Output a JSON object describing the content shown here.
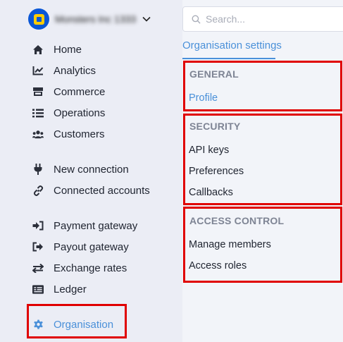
{
  "organisation": {
    "name": "Monsters Inc 1333"
  },
  "sidebar": {
    "items": [
      {
        "id": "home",
        "label": "Home",
        "icon": "home-icon"
      },
      {
        "id": "analytics",
        "label": "Analytics",
        "icon": "analytics-icon"
      },
      {
        "id": "commerce",
        "label": "Commerce",
        "icon": "store-icon"
      },
      {
        "id": "operations",
        "label": "Operations",
        "icon": "list-icon"
      },
      {
        "id": "customers",
        "label": "Customers",
        "icon": "users-icon"
      },
      {
        "id": "new-connection",
        "label": "New connection",
        "icon": "plug-icon"
      },
      {
        "id": "connected-accounts",
        "label": "Connected accounts",
        "icon": "link-icon"
      },
      {
        "id": "payment-gateway",
        "label": "Payment gateway",
        "icon": "sign-in-icon"
      },
      {
        "id": "payout-gateway",
        "label": "Payout gateway",
        "icon": "sign-out-icon"
      },
      {
        "id": "exchange-rates",
        "label": "Exchange rates",
        "icon": "exchange-icon"
      },
      {
        "id": "ledger",
        "label": "Ledger",
        "icon": "ledger-icon"
      },
      {
        "id": "organisation",
        "label": "Organisation",
        "icon": "gear-icon",
        "active": true
      }
    ]
  },
  "search": {
    "placeholder": "Search..."
  },
  "tabs": {
    "active": "Organisation settings"
  },
  "settings": {
    "general": {
      "title": "GENERAL",
      "items": [
        "Profile"
      ]
    },
    "security": {
      "title": "SECURITY",
      "items": [
        "API keys",
        "Preferences",
        "Callbacks"
      ]
    },
    "access_control": {
      "title": "ACCESS CONTROL",
      "items": [
        "Manage members",
        "Access roles"
      ]
    }
  },
  "colors": {
    "accent": "#4a90d9",
    "highlight": "#e00000",
    "sidebar_bg": "#ebedf5",
    "brand": "#0a57d6"
  }
}
